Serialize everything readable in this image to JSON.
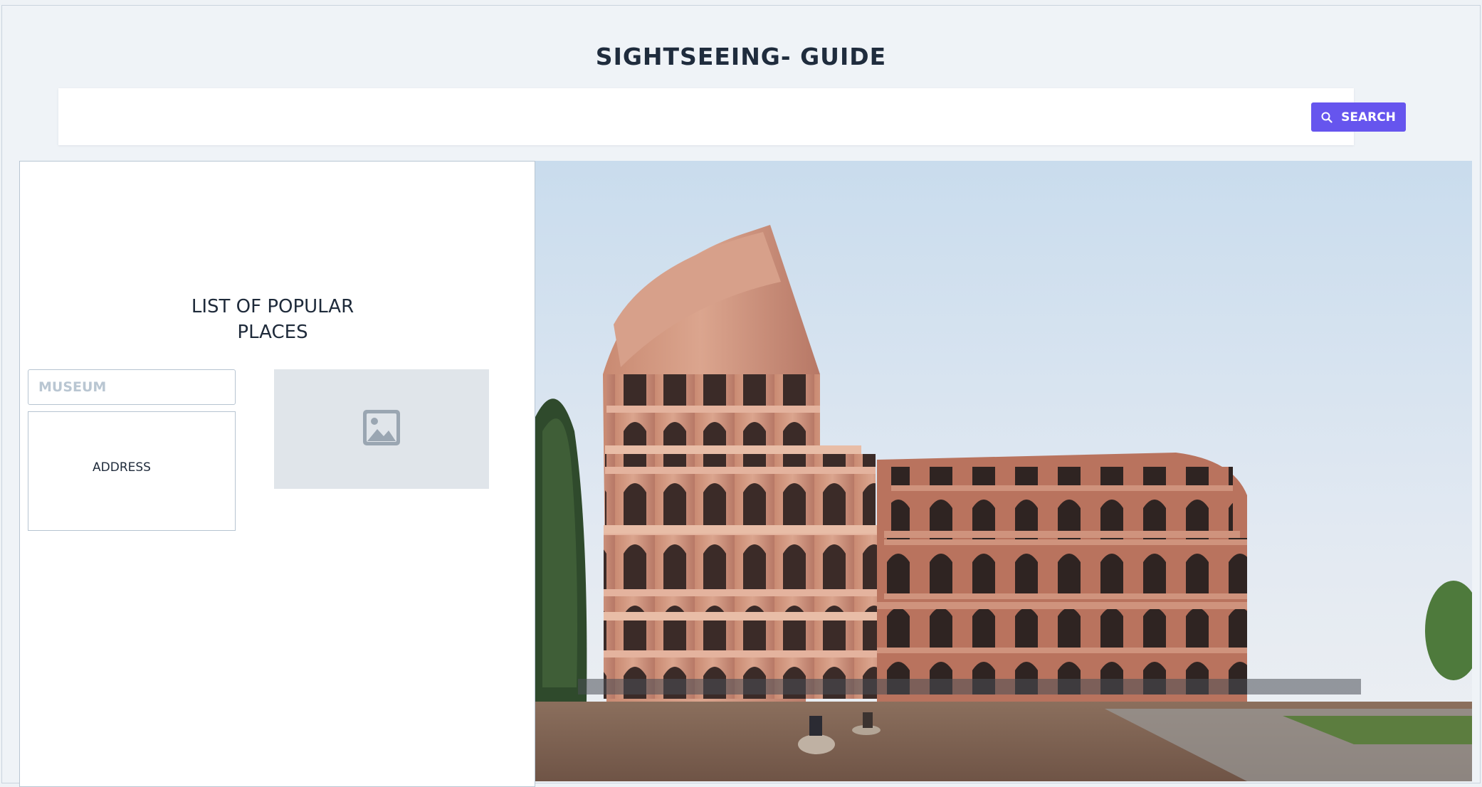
{
  "header": {
    "title": "SIGHTSEEING- GUIDE"
  },
  "search": {
    "placeholder": "",
    "value": "",
    "button_label": "SEARCH",
    "button_color": "#6655ee"
  },
  "places_panel": {
    "title_line1": "LIST OF POPULAR",
    "title_line2": "PLACES",
    "museum_placeholder": "MUSEUM",
    "address_label": "ADDRESS",
    "image_icon": "image-icon"
  },
  "hero": {
    "image_subject": "colosseum-photo"
  },
  "colors": {
    "page_background": "#eff3f7",
    "panel_background": "#ffffff",
    "border": "#b8c6d3",
    "placeholder_background": "#e0e5ea",
    "accent": "#6655ee"
  }
}
